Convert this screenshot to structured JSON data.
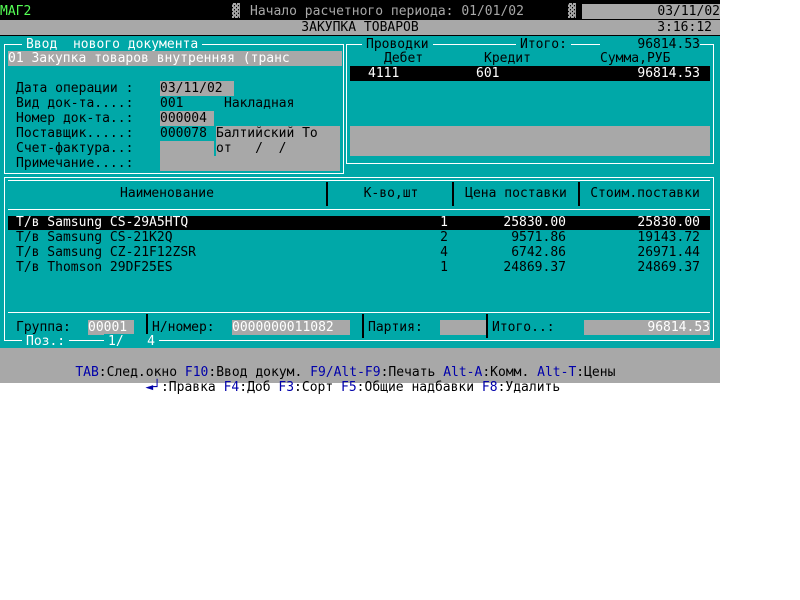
{
  "title_bar": {
    "app": "МАГ2",
    "period_label": "Начало расчетного периода: 01/01/02",
    "date": "03/11/02",
    "time": "3:16:12",
    "screen_title": "ЗАКУПКА ТОВАРОВ"
  },
  "doc_entry": {
    "header": "Ввод  нового документа",
    "doc_type_value": "01 Закупка товаров внутренняя (транс",
    "fields": [
      {
        "label": "Дата операции :",
        "value": "03/11/02",
        "extra": ""
      },
      {
        "label": "Вид док-та....:",
        "value": "001",
        "extra": "Накладная"
      },
      {
        "label": "Номер док-та..:",
        "value": "000004",
        "extra": ""
      },
      {
        "label": "Поставщик.....:",
        "value": "000078",
        "extra": "Балтийский То"
      },
      {
        "label": "Счет-фактура..:",
        "value": "",
        "extra": "от   /  /"
      },
      {
        "label": "Примечание....:",
        "value": "",
        "extra": ""
      }
    ]
  },
  "postings": {
    "header": "Проводки",
    "total_label": "Итого:",
    "total_value": "96814.53",
    "columns": [
      "Дебет",
      "Кредит",
      "Сумма,РУБ"
    ],
    "rows": [
      {
        "debit": "4111",
        "credit": "601",
        "sum": "96814.53"
      }
    ]
  },
  "items": {
    "columns": [
      "Наименование",
      "К-во,шт",
      "Цена поставки",
      "Стоим.поставки"
    ],
    "rows": [
      {
        "name": "Т/в Samsung CS-29A5HTQ",
        "qty": "1",
        "price": "25830.00",
        "cost": "25830.00"
      },
      {
        "name": "Т/в Samsung CS-21K2Q",
        "qty": "2",
        "price": "9571.86",
        "cost": "19143.72"
      },
      {
        "name": "Т/в Samsung CZ-21F12ZSR",
        "qty": "4",
        "price": "6742.86",
        "cost": "26971.44"
      },
      {
        "name": "Т/в Thomson 29DF25ES",
        "qty": "1",
        "price": "24869.37",
        "cost": "24869.37"
      }
    ]
  },
  "bottom": {
    "group_label": "Группа:",
    "group_value": "00001",
    "nnum_label": "Н/номер:",
    "nnum_value": "0000000011082",
    "party_label": "Партия:",
    "party_value": "",
    "total_label": "Итого..:",
    "total_value": "96814.53",
    "pos_label": "Поз.:",
    "pos_value": "1/   4"
  },
  "hotkeys": {
    "line1": [
      {
        "key": "TAB",
        "action": ":След.окно "
      },
      {
        "key": "F10",
        "action": ":Ввод докум. "
      },
      {
        "key": "F9/Alt-F9",
        "action": ":Печать "
      },
      {
        "key": "Alt-A",
        "action": ":Комм. "
      },
      {
        "key": "Alt-T",
        "action": ":Цены"
      }
    ],
    "line2": [
      {
        "key": "◄┘",
        "action": ":Правка "
      },
      {
        "key": "F4",
        "action": ":Доб "
      },
      {
        "key": "F3",
        "action": ":Сорт "
      },
      {
        "key": "F5",
        "action": ":Общие надбавки "
      },
      {
        "key": "F8",
        "action": ":Удалить"
      }
    ]
  },
  "colors": {
    "teal": "#00A8A8",
    "gray": "#A8A8A8",
    "hotkey_blue": "#0000AA",
    "title_green": "#55FF55"
  }
}
